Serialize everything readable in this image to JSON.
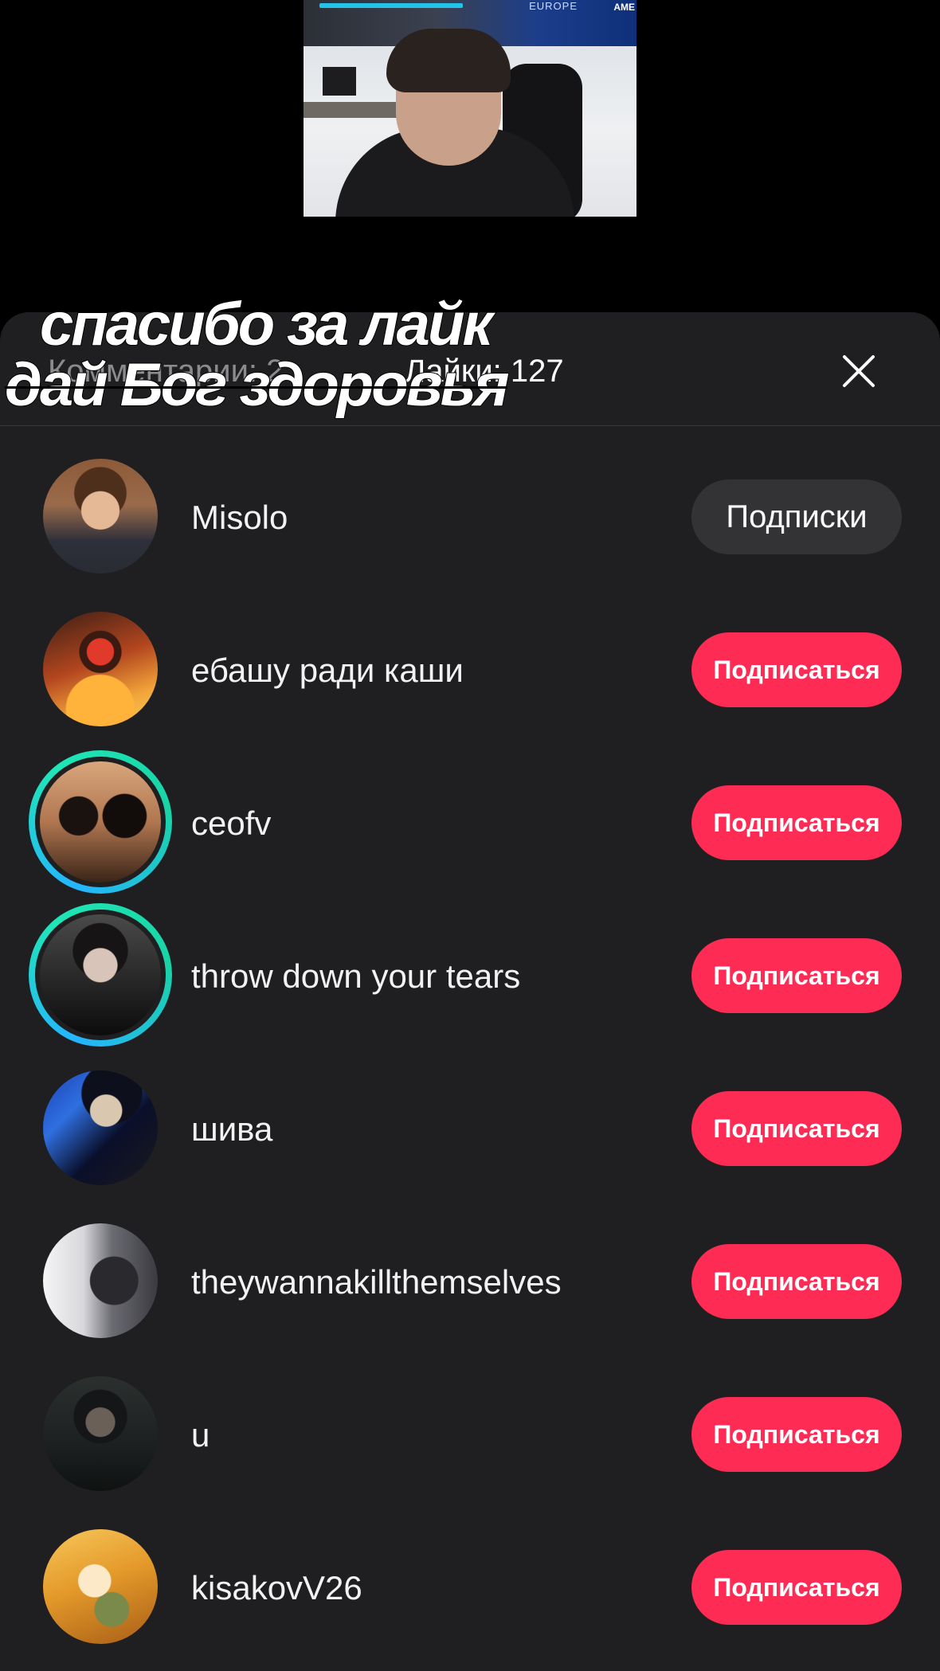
{
  "video": {
    "banner_text_left": "EUROPE",
    "banner_text_right": "AME"
  },
  "caption": {
    "line1": "спасибо за лайк",
    "line2": "дай Бог здоровья"
  },
  "header": {
    "comments_tab": "Комментарии: 2",
    "likes_tab": "Лайки: 127",
    "close_icon": "close-icon"
  },
  "colors": {
    "follow_button": "#fe2c55",
    "following_button": "#333336",
    "sheet_background": "#1f1f21",
    "story_ring_start": "#25b4ff",
    "story_ring_end": "#1fe6b7"
  },
  "users": [
    {
      "name": "Misolo",
      "button": "Подписки",
      "state": "following",
      "story_ring": false
    },
    {
      "name": "ебашу ради каши",
      "button": "Подписаться",
      "state": "follow",
      "story_ring": false
    },
    {
      "name": "ceofv",
      "button": "Подписаться",
      "state": "follow",
      "story_ring": true
    },
    {
      "name": "throw down your tears",
      "button": "Подписаться",
      "state": "follow",
      "story_ring": true
    },
    {
      "name": "шива",
      "button": "Подписаться",
      "state": "follow",
      "story_ring": false
    },
    {
      "name": "theywannakillthemselves",
      "button": "Подписаться",
      "state": "follow",
      "story_ring": false
    },
    {
      "name": "u",
      "button": "Подписаться",
      "state": "follow",
      "story_ring": false
    },
    {
      "name": "kisakovV26",
      "button": "Подписаться",
      "state": "follow",
      "story_ring": false
    }
  ]
}
